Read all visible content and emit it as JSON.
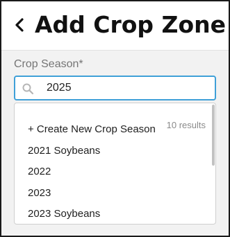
{
  "header": {
    "back_icon": "chevron-left-icon",
    "title": "Add Crop Zone"
  },
  "crop_season": {
    "label": "Crop Season*",
    "search_icon": "search-icon",
    "value": "2025"
  },
  "dropdown": {
    "result_count": "10 results",
    "options": [
      "+ Create New Crop Season",
      "2021 Soybeans",
      "2022",
      "2023",
      "2023 Soybeans"
    ],
    "scroll_position": 0
  },
  "colors": {
    "focus_border": "#3fa0d8",
    "background": "#f2f2f2"
  }
}
